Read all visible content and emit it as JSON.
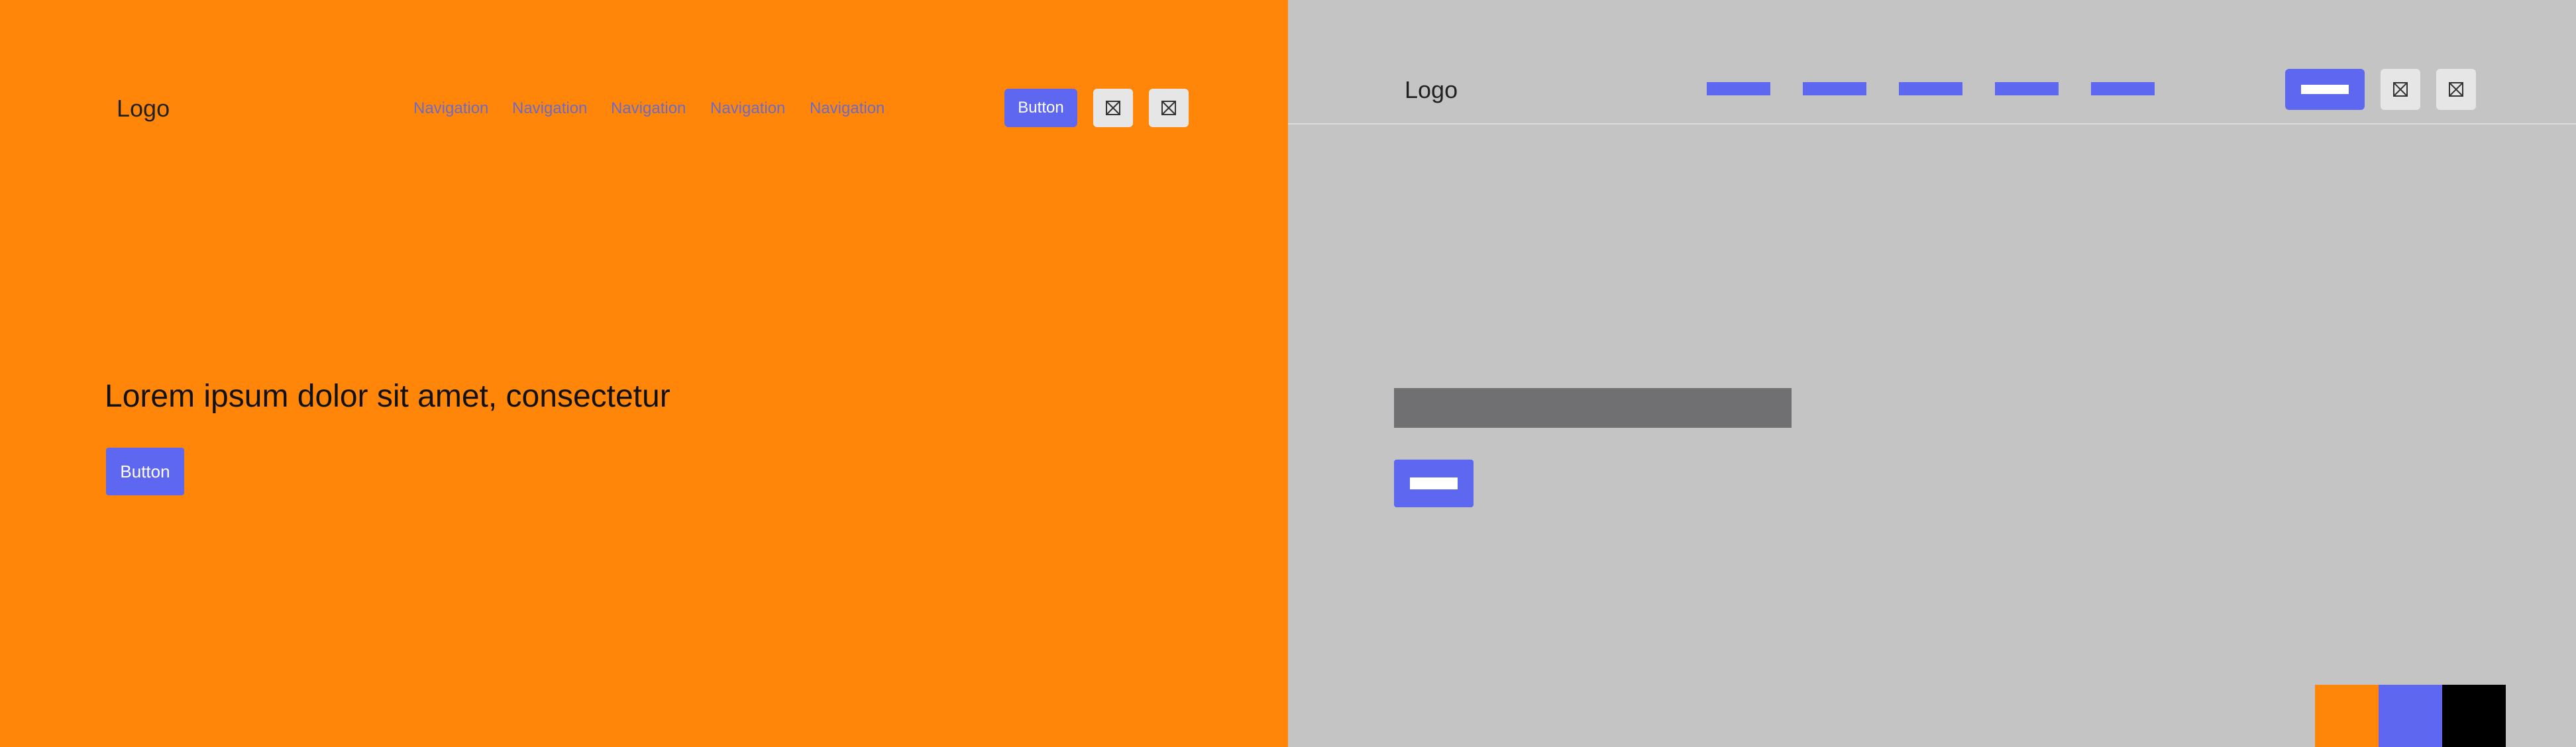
{
  "left": {
    "logo": "Logo",
    "nav": [
      "Navigation",
      "Navigation",
      "Navigation",
      "Navigation",
      "Navigation"
    ],
    "header_button": "Button",
    "icons": [
      "image-placeholder-icon",
      "image-placeholder-icon"
    ],
    "hero_title": "Lorem ipsum dolor sit amet, consectetur",
    "hero_button": "Button"
  },
  "right": {
    "logo": "Logo",
    "icons": [
      "image-placeholder-icon",
      "image-placeholder-icon"
    ]
  },
  "colors": {
    "orange": "#FF8609",
    "accent": "#5E67F0",
    "gray": "#C4C4C4",
    "placeholder": "#707073",
    "black": "#000000"
  },
  "swatches": [
    "#FF8609",
    "#5E67F0",
    "#000000"
  ]
}
